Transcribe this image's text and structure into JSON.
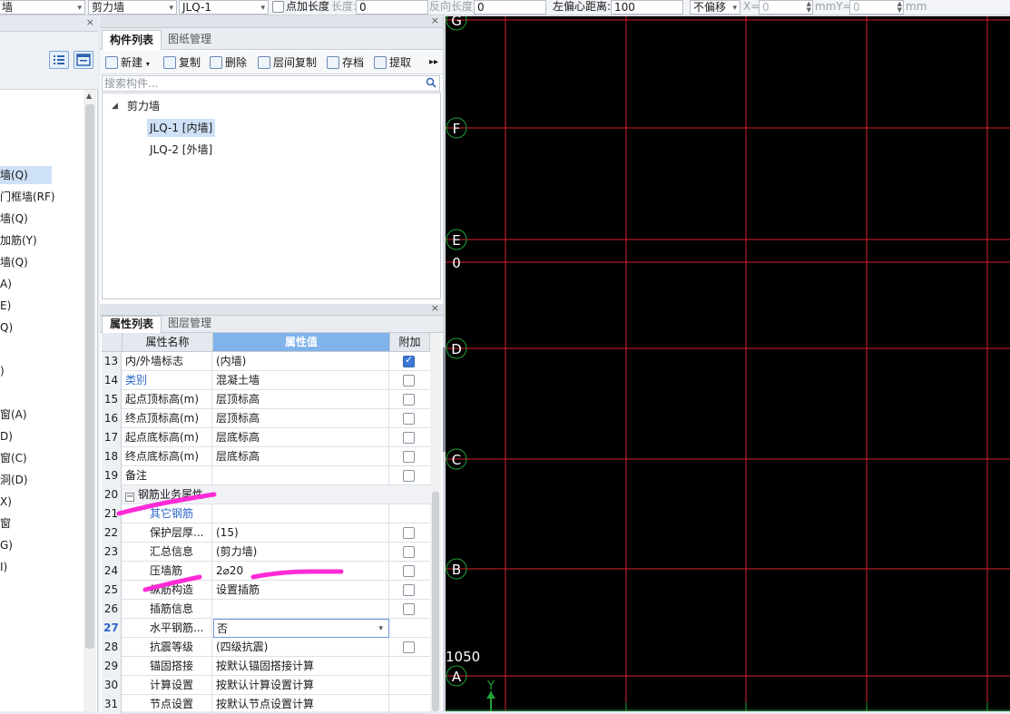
{
  "toolbar": {
    "type_value": "墙",
    "subtype_value": "剪力墙",
    "component_value": "JLQ-1",
    "point_length_label": "点加长度",
    "length_label": "长度:",
    "length_value": "0",
    "reverse_length_label": "反向长度:",
    "reverse_length_value": "0",
    "left_offset_label": "左偏心距离:",
    "left_offset_value": "100",
    "offset_mode_value": "不偏移",
    "x_label": "X=",
    "x_value": "0",
    "mm_y_label": "mmY=",
    "y_value": "0",
    "mm_label": "mm"
  },
  "left_panel": {
    "items": [
      {
        "label": "墙(Q)",
        "selected": true
      },
      {
        "label": "门框墙(RF)"
      },
      {
        "label": "墙(Q)"
      },
      {
        "label": "加筋(Y)"
      },
      {
        "label": "墙(Q)"
      },
      {
        "label": "A)"
      },
      {
        "label": "E)"
      },
      {
        "label": "Q)"
      },
      {
        "label": ")"
      },
      {
        "label": "窗(A)"
      },
      {
        "label": "D)"
      },
      {
        "label": "窗(C)"
      },
      {
        "label": "洞(D)"
      },
      {
        "label": "X)"
      },
      {
        "label": "窗"
      },
      {
        "label": "G)"
      },
      {
        "label": "I)"
      }
    ]
  },
  "component_panel": {
    "tabs": [
      "构件列表",
      "图纸管理"
    ],
    "tools": {
      "new": "新建",
      "copy": "复制",
      "delete": "删除",
      "floor_copy": "层间复制",
      "archive": "存档",
      "extract": "提取"
    },
    "search_placeholder": "搜索构件...",
    "tree_root": "剪力墙",
    "tree_children": [
      "JLQ-1 [内墙]",
      "JLQ-2 [外墙]"
    ]
  },
  "property_panel": {
    "tabs": [
      "属性列表",
      "图层管理"
    ],
    "columns": [
      "属性名称",
      "属性值",
      "附加"
    ],
    "rows": [
      {
        "num": "13",
        "name": "内/外墙标志",
        "value": "(内墙)",
        "check": "on"
      },
      {
        "num": "14",
        "name": "类别",
        "value": "混凝土墙",
        "check": "off",
        "link": true
      },
      {
        "num": "15",
        "name": "起点顶标高(m)",
        "value": "层顶标高",
        "check": "off"
      },
      {
        "num": "16",
        "name": "终点顶标高(m)",
        "value": "层顶标高",
        "check": "off"
      },
      {
        "num": "17",
        "name": "起点底标高(m)",
        "value": "层底标高",
        "check": "off"
      },
      {
        "num": "18",
        "name": "终点底标高(m)",
        "value": "层底标高",
        "check": "off"
      },
      {
        "num": "19",
        "name": "备注",
        "value": "",
        "check": "off"
      },
      {
        "num": "20",
        "name": "钢筋业务属性",
        "value": "",
        "check": "none",
        "group": true
      },
      {
        "num": "21",
        "name": "其它钢筋",
        "value": "",
        "check": "none",
        "link": true,
        "indent": true
      },
      {
        "num": "22",
        "name": "保护层厚...",
        "value": "(15)",
        "check": "off",
        "indent": true
      },
      {
        "num": "23",
        "name": "汇总信息",
        "value": "(剪力墙)",
        "check": "off",
        "indent": true
      },
      {
        "num": "24",
        "name": "压墙筋",
        "value": "2⌀20",
        "check": "off",
        "indent": true
      },
      {
        "num": "25",
        "name": "纵筋构造",
        "value": "设置插筋",
        "check": "off",
        "indent": true
      },
      {
        "num": "26",
        "name": "插筋信息",
        "value": "",
        "check": "off",
        "indent": true
      },
      {
        "num": "27",
        "name": "水平钢筋...",
        "value": "否",
        "check": "none",
        "indent": true,
        "current": true
      },
      {
        "num": "28",
        "name": "抗震等级",
        "value": "(四级抗震)",
        "check": "off",
        "indent": true
      },
      {
        "num": "29",
        "name": "锚固搭接",
        "value": "按默认锚固搭接计算",
        "check": "none",
        "indent": true
      },
      {
        "num": "30",
        "name": "计算设置",
        "value": "按默认计算设置计算",
        "check": "none",
        "indent": true
      },
      {
        "num": "31",
        "name": "节点设置",
        "value": "按默认节点设置计算",
        "check": "none",
        "indent": true
      }
    ]
  },
  "canvas": {
    "axis_labels": [
      "G",
      "F",
      "E",
      "0",
      "D",
      "C",
      "B",
      "A"
    ],
    "dimension_text": "1050",
    "ucs_label": "Y",
    "colors": {
      "background": "#000000",
      "grid_line": "#d9202a",
      "bubble": "#1fa33a",
      "annotation": "#ff2bd6"
    }
  }
}
